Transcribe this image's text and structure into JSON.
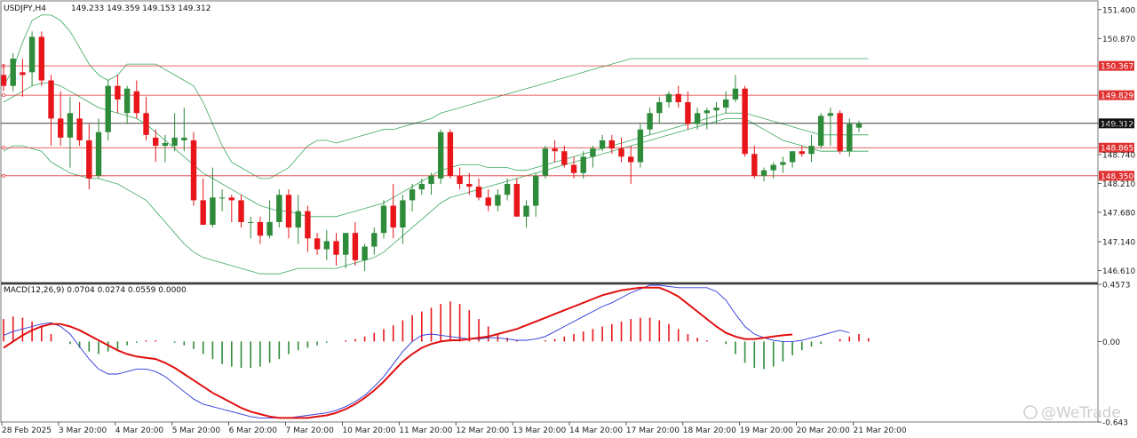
{
  "header": {
    "symbol_info": "USDJPY,H4",
    "ohlc_text": "149.233 149.359 149.153 149.312",
    "indicator_label": "MACD(12,26,9) 0.0704 0.0274 0.0559 0.0000"
  },
  "watermark": "@WeTrade",
  "colors": {
    "bull": "#2e8b3a",
    "bear": "#e8161b",
    "bands": "#3aa85e",
    "hline": "#e03030",
    "current_line": "#222222",
    "macd_line": "#2a35d8",
    "signal_line": "#e01010"
  },
  "chart_data": [
    {
      "type": "candlestick",
      "title": "USDJPY,H4",
      "ylim": [
        146.39,
        151.56
      ],
      "y_ticks": [
        "151.400",
        "150.870",
        "149.312",
        "148.740",
        "148.210",
        "147.680",
        "147.140",
        "146.610"
      ],
      "x_ticks": [
        "28 Feb 2025",
        "3 Mar 20:00",
        "4 Mar 20:00",
        "5 Mar 20:00",
        "6 Mar 20:00",
        "7 Mar 20:00",
        "10 Mar 20:00",
        "11 Mar 20:00",
        "12 Mar 20:00",
        "13 Mar 20:00",
        "14 Mar 20:00",
        "17 Mar 20:00",
        "18 Mar 20:00",
        "19 Mar 20:00",
        "20 Mar 20:00",
        "21 Mar 20:00"
      ],
      "horizontal_levels": [
        {
          "label": "150.367",
          "value": 150.367
        },
        {
          "label": "149.829",
          "value": 149.829
        },
        {
          "label": "148.865",
          "value": 148.865
        },
        {
          "label": "148.350",
          "value": 148.35
        }
      ],
      "current_price": {
        "label": "149.312",
        "value": 149.312
      },
      "candles": [
        [
          150.2,
          150.4,
          149.9,
          150.0
        ],
        [
          150.0,
          150.6,
          149.9,
          150.5
        ],
        [
          150.25,
          150.5,
          149.8,
          150.2
        ],
        [
          150.25,
          151.0,
          150.0,
          150.9
        ],
        [
          150.9,
          151.0,
          150.0,
          150.1
        ],
        [
          150.1,
          150.2,
          148.9,
          149.4
        ],
        [
          149.4,
          149.9,
          148.9,
          149.05
        ],
        [
          149.05,
          149.8,
          148.5,
          149.5
        ],
        [
          149.4,
          149.7,
          148.9,
          149.0
        ],
        [
          149.0,
          149.3,
          148.1,
          148.3
        ],
        [
          148.35,
          149.4,
          148.3,
          149.15
        ],
        [
          149.15,
          150.1,
          149.0,
          150.0
        ],
        [
          150.0,
          150.2,
          149.5,
          149.75
        ],
        [
          149.5,
          150.0,
          149.3,
          149.95
        ],
        [
          149.9,
          150.1,
          149.4,
          149.5
        ],
        [
          149.5,
          149.8,
          149.0,
          149.1
        ],
        [
          149.05,
          149.2,
          148.6,
          148.9
        ],
        [
          148.9,
          149.1,
          148.6,
          148.95
        ],
        [
          148.9,
          149.5,
          148.8,
          149.05
        ],
        [
          149.0,
          149.6,
          148.8,
          149.05
        ],
        [
          149.0,
          149.15,
          147.8,
          147.9
        ],
        [
          147.9,
          148.3,
          147.8,
          147.45
        ],
        [
          147.45,
          148.5,
          147.4,
          147.95
        ],
        [
          147.95,
          148.1,
          147.7,
          147.95
        ],
        [
          147.95,
          148.0,
          147.5,
          147.9
        ],
        [
          147.9,
          148.0,
          147.4,
          147.5
        ],
        [
          147.5,
          147.6,
          147.2,
          147.5
        ],
        [
          147.5,
          147.6,
          147.1,
          147.25
        ],
        [
          147.25,
          147.9,
          147.2,
          147.5
        ],
        [
          147.5,
          148.1,
          147.4,
          148.0
        ],
        [
          148.0,
          148.1,
          147.2,
          147.4
        ],
        [
          147.4,
          148.0,
          147.1,
          147.7
        ],
        [
          147.7,
          147.8,
          146.95,
          147.2
        ],
        [
          147.2,
          147.3,
          146.9,
          147.0
        ],
        [
          147.0,
          147.35,
          146.8,
          147.15
        ],
        [
          147.15,
          147.3,
          146.7,
          146.9
        ],
        [
          146.9,
          147.3,
          146.65,
          147.3
        ],
        [
          147.3,
          147.5,
          146.7,
          146.8
        ],
        [
          146.8,
          147.1,
          146.6,
          147.05
        ],
        [
          147.05,
          147.4,
          146.9,
          147.3
        ],
        [
          147.3,
          147.9,
          147.2,
          147.8
        ],
        [
          147.8,
          148.2,
          147.2,
          147.4
        ],
        [
          147.4,
          148.0,
          147.1,
          147.9
        ],
        [
          147.9,
          148.2,
          147.7,
          148.1
        ],
        [
          148.1,
          148.3,
          148.0,
          148.2
        ],
        [
          148.2,
          148.4,
          148.0,
          148.35
        ],
        [
          148.3,
          149.2,
          148.2,
          149.15
        ],
        [
          149.15,
          149.2,
          148.3,
          148.35
        ],
        [
          148.35,
          148.5,
          148.1,
          148.2
        ],
        [
          148.2,
          148.4,
          148.0,
          148.15
        ],
        [
          148.15,
          148.3,
          147.9,
          147.95
        ],
        [
          147.95,
          148.1,
          147.7,
          147.8
        ],
        [
          147.8,
          148.1,
          147.7,
          148.0
        ],
        [
          148.0,
          148.3,
          147.9,
          148.2
        ],
        [
          148.2,
          148.3,
          147.6,
          147.6
        ],
        [
          147.6,
          147.9,
          147.4,
          147.8
        ],
        [
          147.8,
          148.4,
          147.6,
          148.35
        ],
        [
          148.35,
          148.9,
          148.3,
          148.85
        ],
        [
          148.85,
          149.0,
          148.6,
          148.8
        ],
        [
          148.8,
          148.9,
          148.5,
          148.55
        ],
        [
          148.55,
          148.7,
          148.3,
          148.4
        ],
        [
          148.4,
          148.8,
          148.3,
          148.7
        ],
        [
          148.7,
          148.9,
          148.5,
          148.85
        ],
        [
          148.85,
          149.1,
          148.8,
          149.0
        ],
        [
          149.0,
          149.1,
          148.75,
          148.85
        ],
        [
          148.85,
          149.05,
          148.6,
          148.7
        ],
        [
          148.7,
          148.9,
          148.2,
          148.6
        ],
        [
          148.6,
          149.3,
          148.5,
          149.2
        ],
        [
          149.2,
          149.6,
          149.1,
          149.5
        ],
        [
          149.5,
          149.8,
          149.3,
          149.7
        ],
        [
          149.7,
          149.9,
          149.6,
          149.85
        ],
        [
          149.85,
          150.0,
          149.6,
          149.7
        ],
        [
          149.7,
          149.9,
          149.2,
          149.3
        ],
        [
          149.3,
          149.6,
          149.2,
          149.5
        ],
        [
          149.5,
          149.6,
          149.2,
          149.55
        ],
        [
          149.55,
          149.7,
          149.3,
          149.6
        ],
        [
          149.6,
          149.9,
          149.5,
          149.75
        ],
        [
          149.75,
          150.2,
          149.7,
          149.95
        ],
        [
          149.95,
          150.0,
          148.7,
          148.75
        ],
        [
          148.75,
          148.9,
          148.3,
          148.35
        ],
        [
          148.35,
          148.5,
          148.25,
          148.45
        ],
        [
          148.45,
          148.6,
          148.3,
          148.55
        ],
        [
          148.55,
          148.7,
          148.4,
          148.6
        ],
        [
          148.6,
          148.8,
          148.5,
          148.8
        ],
        [
          148.8,
          148.9,
          148.7,
          148.75
        ],
        [
          148.75,
          149.1,
          148.6,
          148.9
        ],
        [
          148.9,
          149.5,
          148.85,
          149.45
        ],
        [
          149.45,
          149.6,
          148.9,
          149.5
        ],
        [
          149.5,
          149.55,
          148.75,
          148.8
        ],
        [
          148.8,
          149.4,
          148.7,
          149.3
        ],
        [
          149.233,
          149.359,
          149.153,
          149.312
        ]
      ],
      "bands": {
        "upper": [
          150.0,
          150.3,
          150.8,
          151.2,
          151.3,
          151.3,
          151.2,
          151.0,
          150.7,
          150.4,
          150.2,
          150.1,
          150.2,
          150.4,
          150.4,
          150.4,
          150.4,
          150.3,
          150.2,
          150.1,
          150.0,
          149.7,
          149.3,
          148.9,
          148.6,
          148.5,
          148.4,
          148.3,
          148.3,
          148.4,
          148.5,
          148.7,
          148.9,
          149.0,
          149.0,
          148.95,
          149.0,
          149.05,
          149.1,
          149.15,
          149.2,
          149.2,
          149.25,
          149.3,
          149.35,
          149.4,
          149.5,
          149.55,
          149.6,
          149.65,
          149.7,
          149.75,
          149.8,
          149.85,
          149.9,
          149.95,
          150.0,
          150.05,
          150.1,
          150.15,
          150.2,
          150.25,
          150.3,
          150.35,
          150.4,
          150.45,
          150.5,
          150.5,
          150.5,
          150.5,
          150.5,
          150.5,
          150.5,
          150.5,
          150.5,
          150.5,
          150.5,
          150.5,
          150.5,
          150.5,
          150.5,
          150.5,
          150.5,
          150.5,
          150.5,
          150.5,
          150.5,
          150.5,
          150.5,
          150.5,
          150.5,
          150.5
        ],
        "middle": [
          149.7,
          149.8,
          149.9,
          150.0,
          150.05,
          150.05,
          150.0,
          149.9,
          149.8,
          149.7,
          149.6,
          149.55,
          149.5,
          149.45,
          149.4,
          149.3,
          149.15,
          149.0,
          148.85,
          148.7,
          148.55,
          148.4,
          148.3,
          148.2,
          148.1,
          148.0,
          147.9,
          147.8,
          147.75,
          147.7,
          147.7,
          147.65,
          147.6,
          147.6,
          147.6,
          147.6,
          147.65,
          147.7,
          147.75,
          147.8,
          147.85,
          147.95,
          148.05,
          148.15,
          148.25,
          148.35,
          148.45,
          148.5,
          148.55,
          148.55,
          148.55,
          148.5,
          148.5,
          148.5,
          148.45,
          148.45,
          148.5,
          148.55,
          148.6,
          148.65,
          148.7,
          148.75,
          148.8,
          148.85,
          148.9,
          148.95,
          149.0,
          149.05,
          149.1,
          149.15,
          149.2,
          149.25,
          149.3,
          149.35,
          149.4,
          149.45,
          149.5,
          149.5,
          149.5,
          149.45,
          149.4,
          149.35,
          149.3,
          149.25,
          149.2,
          149.15,
          149.1,
          149.1,
          149.1,
          149.1,
          149.1,
          149.1
        ],
        "lower": [
          148.8,
          148.9,
          148.9,
          148.85,
          148.8,
          148.6,
          148.5,
          148.4,
          148.35,
          148.3,
          148.3,
          148.25,
          148.2,
          148.1,
          148.0,
          147.9,
          147.7,
          147.5,
          147.3,
          147.1,
          146.95,
          146.85,
          146.8,
          146.75,
          146.7,
          146.65,
          146.6,
          146.55,
          146.55,
          146.55,
          146.6,
          146.65,
          146.65,
          146.65,
          146.65,
          146.65,
          146.7,
          146.75,
          146.8,
          146.85,
          146.95,
          147.1,
          147.25,
          147.4,
          147.55,
          147.7,
          147.85,
          147.95,
          148.0,
          148.05,
          148.1,
          148.15,
          148.2,
          148.25,
          148.3,
          148.35,
          148.4,
          148.45,
          148.5,
          148.55,
          148.6,
          148.65,
          148.7,
          148.75,
          148.8,
          148.85,
          148.9,
          148.95,
          149.0,
          149.05,
          149.1,
          149.15,
          149.2,
          149.25,
          149.3,
          149.35,
          149.4,
          149.4,
          149.4,
          149.3,
          149.2,
          149.1,
          149.0,
          148.95,
          148.9,
          148.85,
          148.8,
          148.8,
          148.8,
          148.8,
          148.8,
          148.8
        ]
      }
    },
    {
      "type": "macd",
      "title": "MACD(12,26,9) 0.0704 0.0274 0.0559 0.0000",
      "ylim": [
        -0.643,
        0.4573
      ],
      "y_ticks": [
        "0.4573",
        "0.00",
        "-0.643"
      ],
      "histogram": [
        0.18,
        0.2,
        0.19,
        0.16,
        0.12,
        0.06,
        0.0,
        -0.02,
        -0.05,
        -0.08,
        -0.1,
        -0.08,
        -0.06,
        -0.03,
        -0.01,
        0.01,
        0.01,
        0.0,
        -0.01,
        -0.03,
        -0.06,
        -0.1,
        -0.14,
        -0.18,
        -0.2,
        -0.21,
        -0.21,
        -0.2,
        -0.17,
        -0.14,
        -0.1,
        -0.07,
        -0.05,
        -0.03,
        -0.01,
        0.0,
        0.01,
        0.02,
        0.04,
        0.07,
        0.1,
        0.13,
        0.17,
        0.21,
        0.24,
        0.27,
        0.3,
        0.32,
        0.3,
        0.25,
        0.18,
        0.12,
        0.06,
        0.03,
        0.01,
        0.0,
        0.0,
        0.01,
        0.02,
        0.04,
        0.06,
        0.08,
        0.1,
        0.12,
        0.14,
        0.16,
        0.18,
        0.19,
        0.19,
        0.17,
        0.14,
        0.1,
        0.06,
        0.03,
        0.01,
        0.0,
        -0.02,
        -0.1,
        -0.17,
        -0.21,
        -0.22,
        -0.2,
        -0.16,
        -0.11,
        -0.07,
        -0.04,
        -0.02,
        0.0,
        0.02,
        0.04,
        0.06,
        0.0274
      ],
      "macd": [
        0.05,
        0.08,
        0.1,
        0.12,
        0.14,
        0.15,
        0.12,
        0.06,
        -0.04,
        -0.14,
        -0.22,
        -0.26,
        -0.26,
        -0.24,
        -0.22,
        -0.22,
        -0.24,
        -0.28,
        -0.34,
        -0.4,
        -0.46,
        -0.5,
        -0.52,
        -0.54,
        -0.56,
        -0.58,
        -0.6,
        -0.61,
        -0.61,
        -0.61,
        -0.61,
        -0.6,
        -0.59,
        -0.58,
        -0.57,
        -0.55,
        -0.52,
        -0.48,
        -0.43,
        -0.36,
        -0.28,
        -0.18,
        -0.08,
        0.0,
        0.05,
        0.06,
        0.05,
        0.04,
        0.03,
        0.02,
        0.02,
        0.03,
        0.03,
        0.02,
        0.01,
        0.01,
        0.02,
        0.04,
        0.08,
        0.12,
        0.16,
        0.2,
        0.24,
        0.28,
        0.31,
        0.35,
        0.39,
        0.42,
        0.45,
        0.45,
        0.44,
        0.43,
        0.43,
        0.43,
        0.43,
        0.4,
        0.33,
        0.22,
        0.12,
        0.06,
        0.03,
        0.01,
        0.0,
        0.0,
        0.01,
        0.03,
        0.05,
        0.07,
        0.09,
        0.0704
      ],
      "signal": [
        -0.05,
        0.0,
        0.05,
        0.09,
        0.12,
        0.14,
        0.14,
        0.12,
        0.09,
        0.05,
        0.01,
        -0.03,
        -0.07,
        -0.1,
        -0.12,
        -0.13,
        -0.14,
        -0.17,
        -0.21,
        -0.26,
        -0.31,
        -0.36,
        -0.41,
        -0.45,
        -0.49,
        -0.53,
        -0.56,
        -0.58,
        -0.6,
        -0.61,
        -0.61,
        -0.61,
        -0.61,
        -0.6,
        -0.59,
        -0.57,
        -0.54,
        -0.5,
        -0.45,
        -0.39,
        -0.32,
        -0.24,
        -0.16,
        -0.1,
        -0.05,
        -0.02,
        0.0,
        0.01,
        0.01,
        0.02,
        0.03,
        0.04,
        0.06,
        0.08,
        0.1,
        0.13,
        0.16,
        0.19,
        0.22,
        0.25,
        0.28,
        0.31,
        0.34,
        0.37,
        0.39,
        0.41,
        0.42,
        0.43,
        0.43,
        0.43,
        0.4,
        0.36,
        0.3,
        0.24,
        0.18,
        0.12,
        0.07,
        0.04,
        0.02,
        0.02,
        0.03,
        0.04,
        0.05,
        0.0559
      ]
    }
  ]
}
